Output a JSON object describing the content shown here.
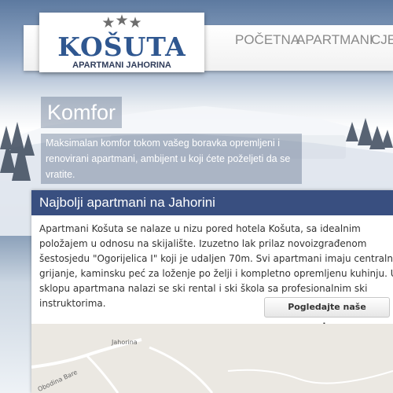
{
  "logo": {
    "title": "KOŠUTA",
    "subtitle": "APARTMANI JAHORINA",
    "stars": [
      "★",
      "★",
      "★"
    ]
  },
  "nav": {
    "items": [
      "POČETNA",
      "APARTMANI",
      "CJEN"
    ]
  },
  "hero": {
    "title": "Komfor",
    "text": "Maksimalan komfor tokom vašeg boravka opremljeni i renovirani apartmani, ambijent u koji ćete poželjeti da se vratite."
  },
  "card": {
    "title": "Najbolji apartmani na Jahorini",
    "body": "Apartmani Košuta se nalaze u nizu pored hotela Košuta, sa idealnim položajem u odnosu na skijalište. Izuzetno lak prilaz novoizgrađenom šestosjedu \"Ogorijelica I\" koji je udaljen 70m. Svi apartmani imaju centralno grijanje, kaminsku peć za loženje po želji i kompletno opremljenu kuhinju. U sklopu apartmana nalazi se ski rental i ski škola sa profesionalnim ski instruktorima.",
    "button": "Pogledajte naše apartmane"
  },
  "map": {
    "labels": [
      "Jahorina",
      "Obodina Bare"
    ]
  },
  "colors": {
    "brand": "#2f5790",
    "card_header": "#394f80",
    "nav_text": "#8a8a8a"
  }
}
